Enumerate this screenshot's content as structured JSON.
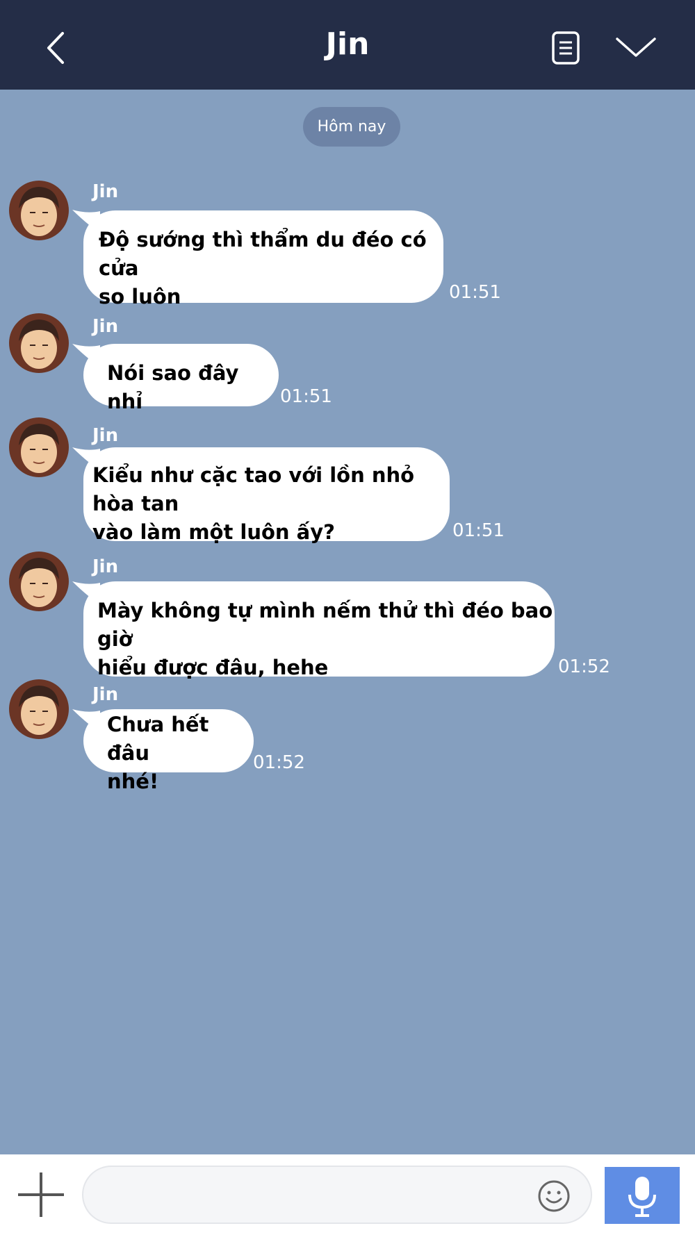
{
  "header": {
    "title": "Jin",
    "back_icon": "chevron-left-icon",
    "notes_icon": "notes-icon",
    "menu_icon": "chevron-down-icon",
    "background": "#242d47"
  },
  "chat": {
    "date_label": "Hôm nay",
    "background": "#859fbf",
    "messages": [
      {
        "sender": "Jin",
        "lines": [
          "Độ sướng thì thẩm du đéo có cửa",
          "so luôn"
        ],
        "time": "01:51"
      },
      {
        "sender": "Jin",
        "lines": [
          "Nói sao đây nhỉ"
        ],
        "time": "01:51"
      },
      {
        "sender": "Jin",
        "lines": [
          "Kiểu như cặc tao với lồn nhỏ hòa tan",
          "vào làm một luôn ấy?"
        ],
        "time": "01:51"
      },
      {
        "sender": "Jin",
        "lines": [
          "Mày không tự mình nếm thử thì đéo bao giờ",
          "hiểu được đâu, hehe"
        ],
        "time": "01:52"
      },
      {
        "sender": "Jin",
        "lines": [
          "Chưa hết đâu",
          "nhé!"
        ],
        "time": "01:52"
      }
    ]
  },
  "input_bar": {
    "message_value": "",
    "plus_icon": "plus-icon",
    "emoji_icon": "emoji-icon",
    "mic_icon": "microphone-icon",
    "mic_color": "#5f8de4"
  }
}
